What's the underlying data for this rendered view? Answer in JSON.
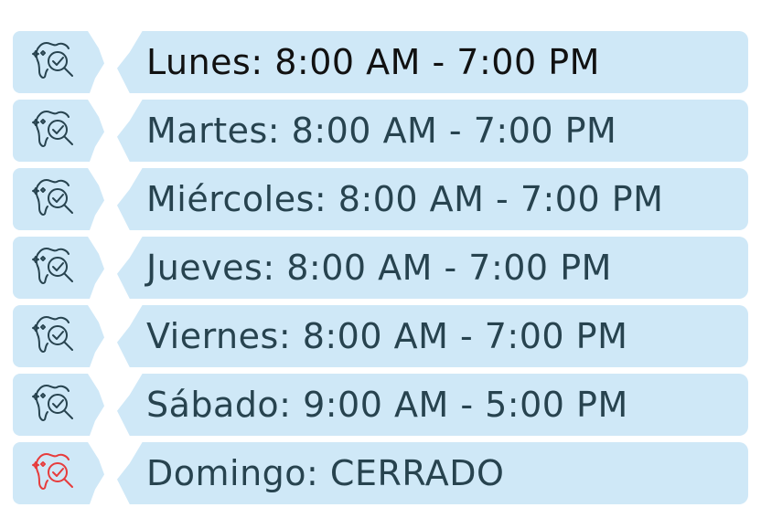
{
  "days": [
    {
      "label": "Lunes: 8:00 AM - 7:00 PM",
      "icon": "tooth-magnifier-icon"
    },
    {
      "label": "Martes: 8:00 AM - 7:00 PM",
      "icon": "tooth-magnifier-icon"
    },
    {
      "label": "Miércoles: 8:00 AM - 7:00 PM",
      "icon": "tooth-magnifier-icon"
    },
    {
      "label": "Jueves: 8:00 AM - 7:00 PM",
      "icon": "tooth-magnifier-icon"
    },
    {
      "label": "Viernes: 8:00 AM - 7:00 PM",
      "icon": "tooth-magnifier-icon"
    },
    {
      "label": "Sábado: 9:00 AM - 5:00 PM",
      "icon": "tooth-magnifier-icon"
    },
    {
      "label": "Domingo: CERRADO",
      "icon": "tooth-magnifier-icon"
    }
  ],
  "colors": {
    "row_background": "#cfe8f7",
    "text": "#27434f",
    "open_icon": "#27434f",
    "closed_icon": "#e73c3c"
  }
}
